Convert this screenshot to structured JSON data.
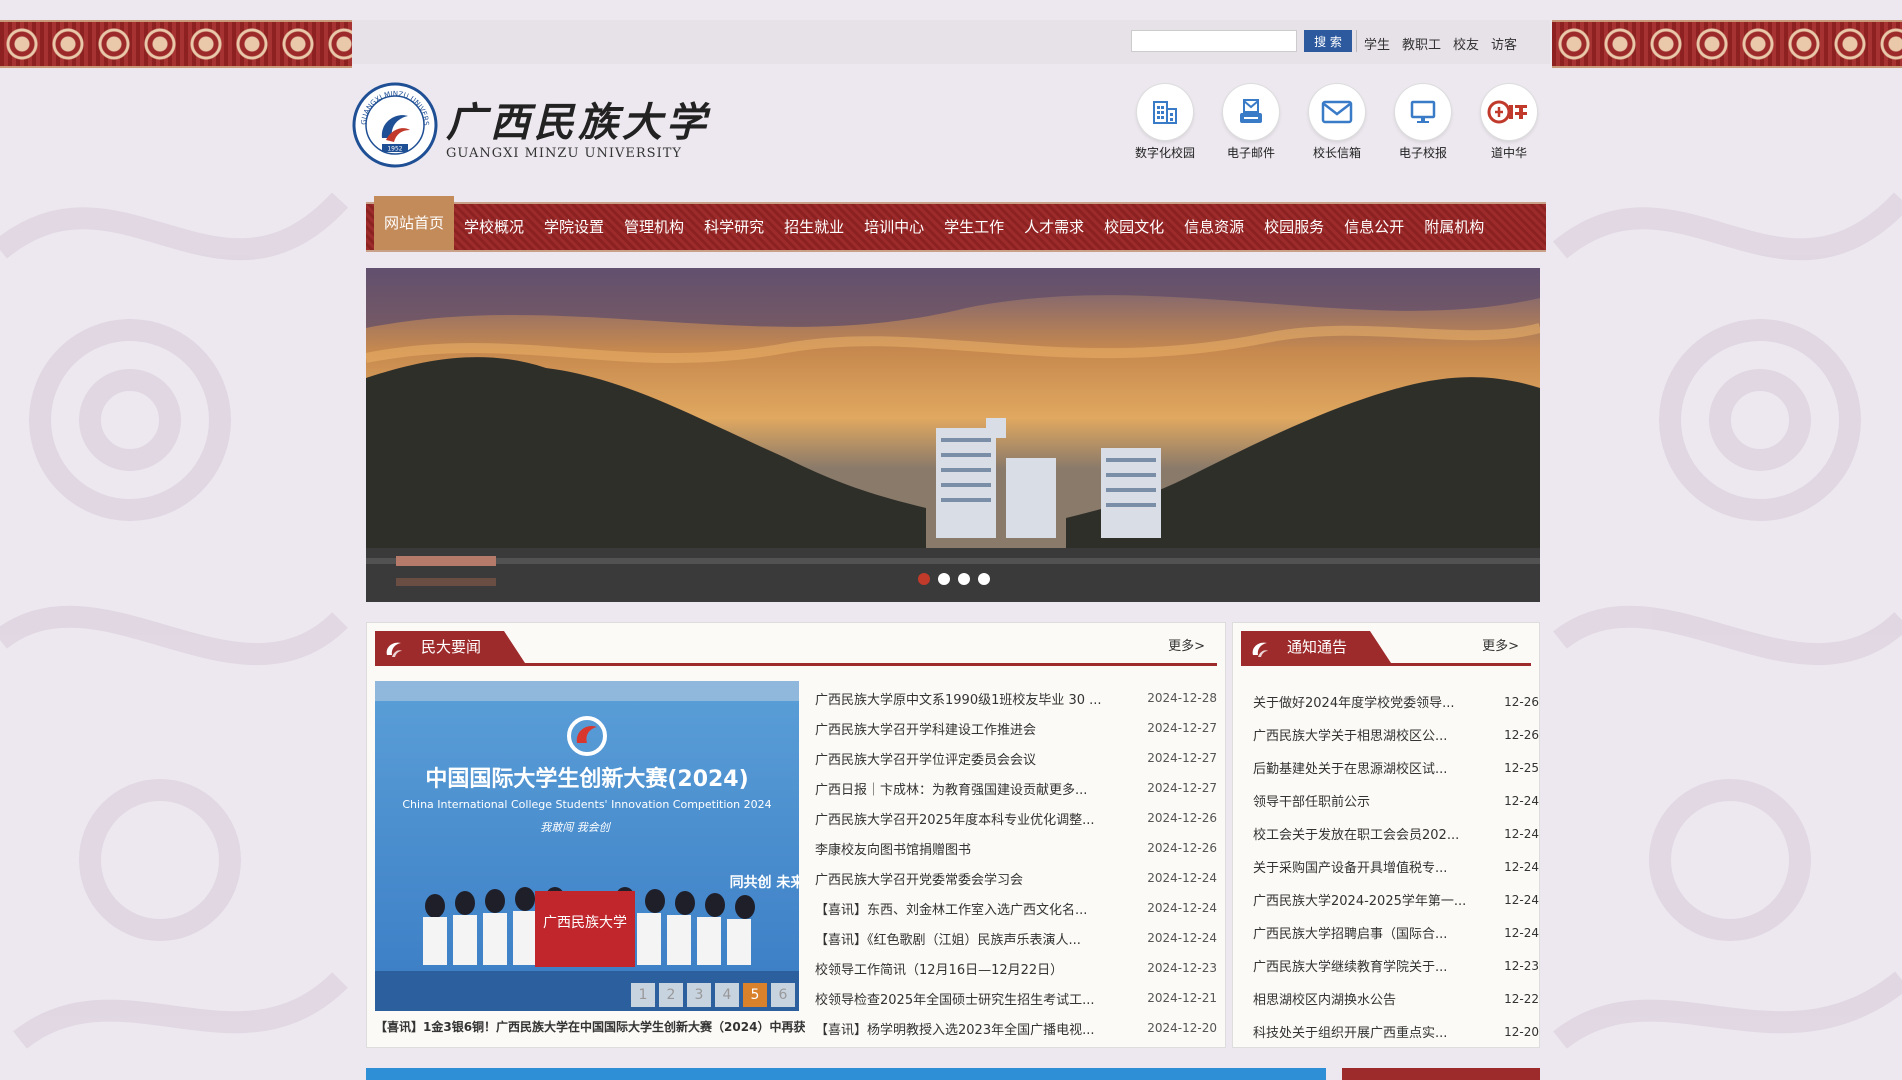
{
  "header": {
    "search_placeholder": "",
    "search_button": "搜 索",
    "audience_links": [
      "学生",
      "教职工",
      "校友",
      "访客"
    ]
  },
  "logo": {
    "cn": "广西民族大学",
    "en": "GUANGXI MINZU UNIVERSITY",
    "seal_text": "GUANGXI MINZU UNIVERSITY",
    "seal_year": "1952"
  },
  "quick_links": [
    {
      "label": "数字化校园",
      "icon": "building-icon"
    },
    {
      "label": "电子邮件",
      "icon": "mail-server-icon"
    },
    {
      "label": "校长信箱",
      "icon": "envelope-icon"
    },
    {
      "label": "电子校报",
      "icon": "monitor-icon"
    },
    {
      "label": "道中华",
      "icon": "daozhonghua-logo-icon"
    }
  ],
  "nav": {
    "items": [
      "网站首页",
      "学校概况",
      "学院设置",
      "管理机构",
      "科学研究",
      "招生就业",
      "培训中心",
      "学生工作",
      "人才需求",
      "校园文化",
      "信息资源",
      "校园服务",
      "信息公开",
      "附属机构"
    ],
    "active_index": 0
  },
  "banner": {
    "slide_count": 4,
    "active_slide": 0
  },
  "news": {
    "heading": "民大要闻",
    "more": "更多>",
    "photo": {
      "title_cn": "中国国际大学生创新大赛(2024)",
      "title_en": "China International College Students' Innovation Competition 2024",
      "slogan": "我敢闯 我会创",
      "flag_text": "广西民族大学",
      "backdrop_text": "同共创 未来",
      "pages": [
        "1",
        "2",
        "3",
        "4",
        "5",
        "6"
      ],
      "active_page": 4
    },
    "caption": "【喜讯】1金3银6铜！广西民族大学在中国国际大学生创新大赛（2024）中再获",
    "items": [
      {
        "title": "广西民族大学原中文系1990级1班校友毕业 30 ...",
        "date": "2024-12-28"
      },
      {
        "title": "广西民族大学召开学科建设工作推进会",
        "date": "2024-12-27"
      },
      {
        "title": "广西民族大学召开学位评定委员会会议",
        "date": "2024-12-27"
      },
      {
        "title": "广西日报｜卞成林：为教育强国建设贡献更多...",
        "date": "2024-12-27"
      },
      {
        "title": "广西民族大学召开2025年度本科专业优化调整...",
        "date": "2024-12-26"
      },
      {
        "title": "李康校友向图书馆捐赠图书",
        "date": "2024-12-26"
      },
      {
        "title": "广西民族大学召开党委常委会学习会",
        "date": "2024-12-24"
      },
      {
        "title": "【喜讯】东西、刘金林工作室入选广西文化名...",
        "date": "2024-12-24"
      },
      {
        "title": "【喜讯】《红色歌剧（江姐）民族声乐表演人...",
        "date": "2024-12-24"
      },
      {
        "title": "校领导工作简讯（12月16日—12月22日）",
        "date": "2024-12-23"
      },
      {
        "title": "校领导检查2025年全国硕士研究生招生考试工...",
        "date": "2024-12-21"
      },
      {
        "title": "【喜讯】杨学明教授入选2023年全国广播电视...",
        "date": "2024-12-20"
      }
    ]
  },
  "notices": {
    "heading": "通知通告",
    "more": "更多>",
    "items": [
      {
        "title": "关于做好2024年度学校党委领导...",
        "date": "12-26"
      },
      {
        "title": "广西民族大学关于相思湖校区公...",
        "date": "12-26"
      },
      {
        "title": "后勤基建处关于在思源湖校区试...",
        "date": "12-25"
      },
      {
        "title": "领导干部任职前公示",
        "date": "12-24"
      },
      {
        "title": "校工会关于发放在职工会会员202...",
        "date": "12-24"
      },
      {
        "title": "关于采购国产设备开具增值税专...",
        "date": "12-24"
      },
      {
        "title": "广西民族大学2024-2025学年第一...",
        "date": "12-24"
      },
      {
        "title": "广西民族大学招聘启事（国际合...",
        "date": "12-24"
      },
      {
        "title": "广西民族大学继续教育学院关于...",
        "date": "12-23"
      },
      {
        "title": "相思湖校区内湖换水公告",
        "date": "12-22"
      },
      {
        "title": "科技处关于组织开展广西重点实...",
        "date": "12-20"
      }
    ]
  },
  "colors": {
    "brand_red": "#9e2b2b",
    "nav_active": "#c38a5a",
    "search_blue": "#2d5a9e",
    "page_bg": "#ece7ee"
  }
}
